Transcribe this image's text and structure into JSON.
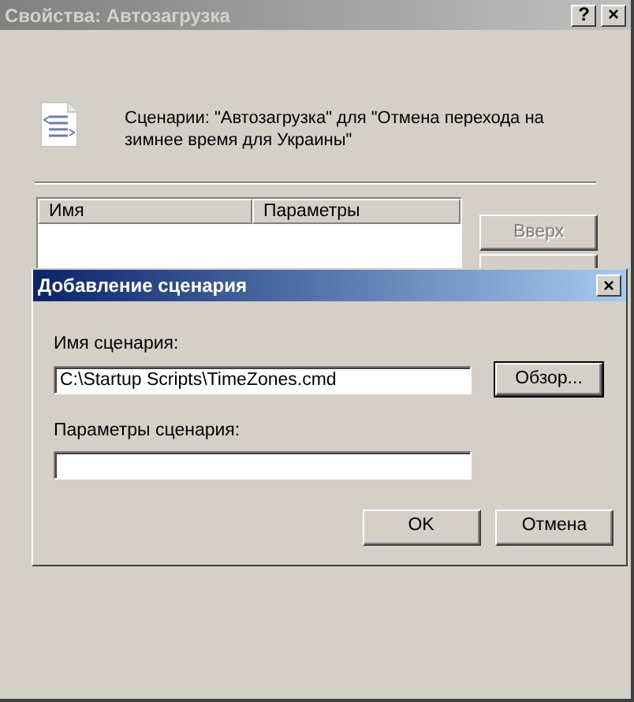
{
  "window": {
    "title": "Свойства: Автозагрузка",
    "help_button": "?",
    "close_button": "×"
  },
  "header": {
    "text": "Сценарии: \"Автозагрузка\" для \"Отмена перехода на зимнее время для Украины\""
  },
  "scripts_list": {
    "columns": [
      "Имя",
      "Параметры"
    ]
  },
  "side_buttons": [
    {
      "label": "Вверх",
      "disabled": true
    }
  ],
  "dialog": {
    "title": "Добавление сценария",
    "close_button": "×",
    "fields": [
      {
        "label": "Имя сценария:",
        "value": "C:\\Startup Scripts\\TimeZones.cmd",
        "button": {
          "label": "Обзор...",
          "default": true
        }
      },
      {
        "label": "Параметры сценария:"
      }
    ],
    "buttons": [
      {
        "label": "OK",
        "default": false
      },
      {
        "label": "Отмена",
        "default": false
      }
    ]
  }
}
